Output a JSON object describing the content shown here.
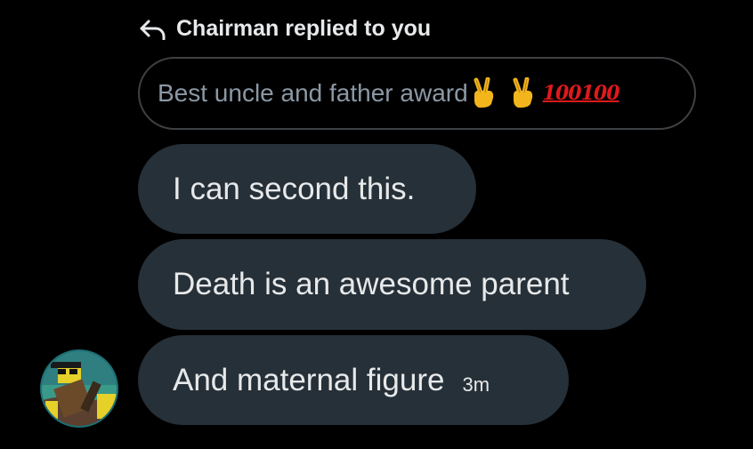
{
  "reply": {
    "icon": "reply-arrow-icon",
    "text": "Chairman replied to you"
  },
  "quoted_message": {
    "text": "Best uncle and father award",
    "emojis": [
      "victory-hand-icon",
      "victory-hand-icon",
      "hundred-points-icon"
    ],
    "hundred_glyphs": "100100"
  },
  "messages": [
    {
      "text": "I can second this."
    },
    {
      "text": "Death is an awesome parent"
    },
    {
      "text": "And maternal figure",
      "time": "3m"
    }
  ],
  "avatar": {
    "icon": "roblox-avatar-icon"
  },
  "colors": {
    "background": "#000000",
    "bubble": "#263038",
    "quoted_border": "#3e4144",
    "quoted_text": "#8b98a5",
    "text": "#e7e9ea",
    "hundred": "#e0191c"
  }
}
